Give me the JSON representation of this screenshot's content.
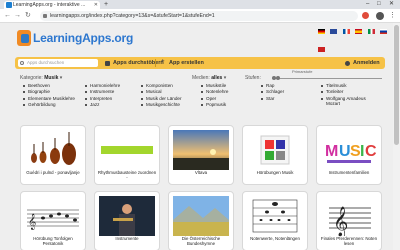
{
  "browser": {
    "tab_title": "LearningApps.org - interaktive ...",
    "url": "learningapps.org/index.php?category=13&s=&stufeStart=1&stufeEnd=1"
  },
  "site": {
    "logo_text": "LearningApps.org"
  },
  "toolbar": {
    "search_placeholder": "Apps durchsuchen",
    "browse_label": "Apps durchstöbern",
    "create_label": "App erstellen",
    "login_label": "Anmelden"
  },
  "filters": {
    "category_label": "Kategorie:",
    "category_value": "Musik",
    "media_label": "Medien:",
    "media_value": "alles",
    "level_label": "Stufen:",
    "level_caption": "Primarstufe"
  },
  "categories": [
    [
      "Beethoven",
      "Biographie",
      "Elementare Musiklehre",
      "Gehörbildung"
    ],
    [
      "Harmonielehre",
      "Instrumente",
      "Interpreten",
      "Jazz"
    ],
    [
      "Komponisten",
      "Musical",
      "Musik der Länder",
      "Musikgeschichte"
    ],
    [
      "Musikstile",
      "Notenlehre",
      "Oper",
      "Popmusik"
    ],
    [
      "Rap",
      "Schlager",
      "Star"
    ],
    [
      "Titelmusik",
      "Tonleiter",
      "Wolfgang Amadeus Mozart"
    ]
  ],
  "cards": [
    {
      "caption": "Guédri i pulnd - ponavljanje"
    },
    {
      "caption": "Rhythmusbausteine zuordnen -"
    },
    {
      "caption": "Vltava"
    },
    {
      "caption": "Hörübungen Musik"
    },
    {
      "caption": "Instrumentenfamilien"
    },
    {
      "caption": "Hörübung Tonfolgen Pentatonik"
    },
    {
      "caption": "Instrumente"
    },
    {
      "caption": "Die Österreichische Bundeshymne"
    },
    {
      "caption": "Notenwerte, Notenlängen"
    },
    {
      "caption": "Finales Pferderennen: Noten lesen"
    }
  ],
  "icons": {
    "lock": "lock-icon",
    "search": "search-icon",
    "browse": "grid-icon",
    "create": "plus-icon",
    "login": "user-icon"
  },
  "colors": {
    "toolbar_bg": "#f6c247",
    "logo_blue": "#2d77cf"
  }
}
